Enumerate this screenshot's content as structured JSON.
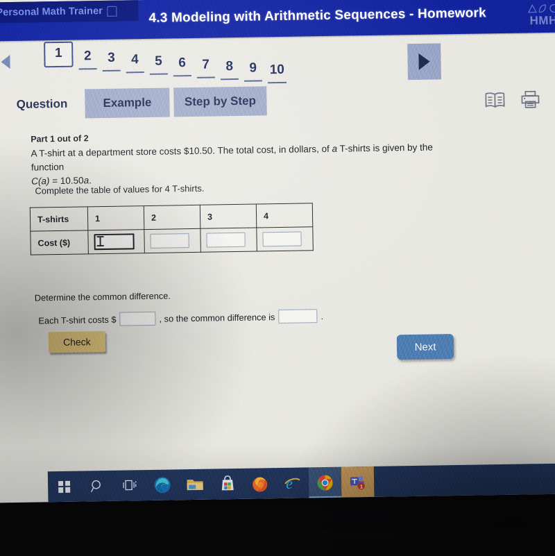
{
  "header": {
    "app_name": "Personal Math Trainer",
    "app_icon": "house-icon",
    "title": "4.3 Modeling with Arithmetic Sequences - Homework",
    "brand": "HMH",
    "brand_color": "#12229b"
  },
  "pager": {
    "prev_icon": "triangle-left-icon",
    "next_icon": "triangle-right-icon",
    "current": "1",
    "pages": [
      "1",
      "2",
      "3",
      "4",
      "5",
      "6",
      "7",
      "8",
      "9",
      "10"
    ]
  },
  "tabs": [
    {
      "label": "Question",
      "active": true
    },
    {
      "label": "Example",
      "active": false
    },
    {
      "label": "Step by Step",
      "active": false
    }
  ],
  "tools": [
    {
      "name": "glossary-icon",
      "label": "Glossary"
    },
    {
      "name": "print-icon",
      "label": "Print"
    }
  ],
  "question": {
    "part": "Part 1 out of 2",
    "body_line1": "A T-shirt at a department store costs $10.50. The total cost, in dollars, of ",
    "body_italic_a": "a",
    "body_line1_end": " T-shirts is given by the function",
    "body_line2_fn": "C(a)",
    "body_line2_rest": " = 10.50",
    "body_line2_var": "a",
    "body_line2_period": ".",
    "instruction": "Complete the table of values for 4 T-shirts."
  },
  "table": {
    "row_labels": [
      "T-shirts",
      "Cost ($)"
    ],
    "tshirt_values": [
      "1",
      "2",
      "3",
      "4"
    ],
    "cost_values": [
      "",
      "",
      "",
      ""
    ],
    "focused_cell_index": 0
  },
  "determine": {
    "prompt": "Determine the common difference.",
    "sentence_part1": "Each T-shirt costs $",
    "input1_value": "",
    "sentence_part2": ", so the common difference is",
    "input2_value": "",
    "sentence_end": "."
  },
  "buttons": {
    "check": {
      "label": "Check",
      "color": "#e0c378"
    },
    "next": {
      "label": "Next",
      "color": "#4d7cb0"
    }
  },
  "taskbar": {
    "items": [
      {
        "name": "start-button",
        "label": "Start"
      },
      {
        "name": "search-icon",
        "label": "Search"
      },
      {
        "name": "task-view-icon",
        "label": "Task View"
      },
      {
        "name": "microsoft-edge-icon",
        "label": "Microsoft Edge"
      },
      {
        "name": "file-explorer-icon",
        "label": "File Explorer"
      },
      {
        "name": "microsoft-store-icon",
        "label": "Microsoft Store"
      },
      {
        "name": "firefox-icon",
        "label": "Firefox"
      },
      {
        "name": "internet-explorer-icon",
        "label": "Internet Explorer"
      },
      {
        "name": "google-chrome-icon",
        "label": "Google Chrome"
      },
      {
        "name": "microsoft-teams-icon",
        "label": "Microsoft Teams"
      }
    ],
    "teams_badge": "1"
  }
}
